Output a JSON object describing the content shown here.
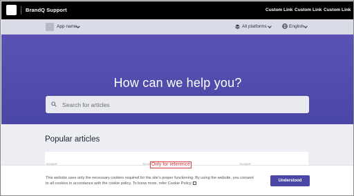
{
  "topbar": {
    "brand": "BrandQ Support",
    "links": [
      "Custom Link",
      "Custom Link",
      "Custom Link"
    ]
  },
  "subbar": {
    "app_selector": "App name",
    "platform_selector": "All platforms",
    "language_selector": "English"
  },
  "hero": {
    "title": "How can we help you?",
    "search_placeholder": "Search for articles"
  },
  "popular": {
    "heading": "Popular articles",
    "card_labels": [
      "Account",
      "Account",
      "Account"
    ]
  },
  "reference_label": "Only for reference",
  "cookie_banner": {
    "text": "This website uses only the necessary cookies required for the site's proper functioning. By using the website, you consent to all cookies in accordance with the cookie policy. To know more, refer Cookie Policy.",
    "button": "Understood"
  },
  "colors": {
    "topbar": "#000000",
    "hero": "#5a53b4",
    "accent_button": "#4b47a6",
    "reference_border": "#d83a3a"
  }
}
